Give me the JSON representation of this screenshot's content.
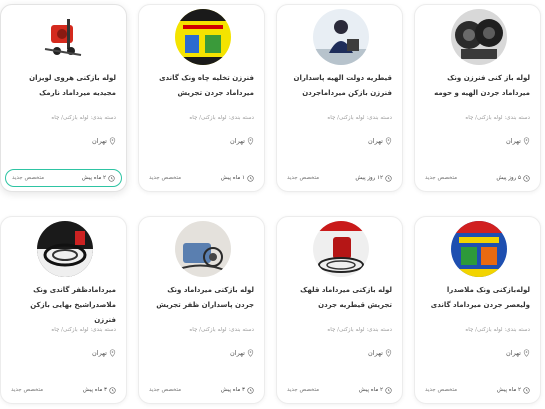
{
  "cards": [
    {
      "title": "لوله باز کنی فنرزن ونک میرداماد جردن الهیه و حومه",
      "category": "دسته بندی: لوله بازکنی/ چاه",
      "location": "تهران",
      "time": "۵ روز پیش",
      "badge": "متخصص جدید",
      "image": "tires"
    },
    {
      "title": "قیطریه دولت الهیه پاسداران فنرزن بازکن میرداماجردن",
      "category": "دسته بندی: لوله بازکنی/ چاه",
      "location": "تهران",
      "time": "۱۲ روز پیش",
      "badge": "متخصص جدید",
      "image": "plumber"
    },
    {
      "title": "فنرزن تخلیه چاه ونک گاندی میرداماد جردن تجریش",
      "category": "دسته بندی: لوله بازکنی/ چاه",
      "location": "تهران",
      "time": "۱ ماه پیش",
      "badge": "متخصص جدید",
      "image": "yellow-poster"
    },
    {
      "title": "لوله بازکنی هروی لویزان مجیدیه میرداماد نارمک",
      "category": "دسته بندی: لوله بازکنی/ چاه",
      "location": "تهران",
      "time": "۲ ماه پیش",
      "badge": "متخصص جدید",
      "image": "pump"
    },
    {
      "title": "لوله‌بازکنی ونک ملاصدرا ولیعصر جردن میرداماد گاندی",
      "category": "دسته بندی: لوله بازکنی/ چاه",
      "location": "تهران",
      "time": "۲ ماه پیش",
      "badge": "متخصص جدید",
      "image": "blue-poster"
    },
    {
      "title": "لوله بازکنی میرداماد قلهک تجریش قیطریه جردن",
      "category": "دسته بندی: لوله بازکنی/ چاه",
      "location": "تهران",
      "time": "۲ ماه پیش",
      "badge": "متخصص جدید",
      "image": "red-machine"
    },
    {
      "title": "لوله بازکنی میرداماد ونک جردن پاسداران ظفر تجریش",
      "category": "دسته بندی: لوله بازکنی/ چاه",
      "location": "تهران",
      "time": "۳ ماه پیش",
      "badge": "متخصص جدید",
      "image": "cables"
    },
    {
      "title": "میردامادظفر گاندی ونک ملاصدراشیخ بهایی بازکن فنرزن",
      "category": "دسته بندی: لوله بازکنی/ چاه",
      "location": "تهران",
      "time": "۳ ماه پیش",
      "badge": "متخصص جدید",
      "image": "coil"
    }
  ],
  "colors": {
    "highlight_border": "#2ec4a3",
    "card_border": "#ececec",
    "muted_text": "#9a9a9a"
  },
  "icons": {
    "location": "location-pin-icon",
    "time": "clock-icon"
  }
}
